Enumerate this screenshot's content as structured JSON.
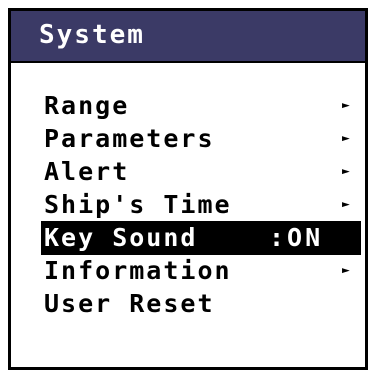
{
  "menu": {
    "title": "System",
    "items": [
      {
        "label": "Range",
        "arrow": "►",
        "value": ""
      },
      {
        "label": "Parameters",
        "arrow": "►",
        "value": ""
      },
      {
        "label": "Alert",
        "arrow": "►",
        "value": ""
      },
      {
        "label": "Ship's Time",
        "arrow": "►",
        "value": ""
      },
      {
        "label": "Key Sound",
        "arrow": "",
        "value": ":ON"
      },
      {
        "label": "Information",
        "arrow": "►",
        "value": ""
      },
      {
        "label": "User Reset",
        "arrow": "",
        "value": ""
      }
    ],
    "selected_item": "Key Sound"
  },
  "colors": {
    "header_background": "#3b3a66",
    "header_text": "#ffffff",
    "selection_background": "#000000",
    "selection_text": "#ffffff"
  }
}
